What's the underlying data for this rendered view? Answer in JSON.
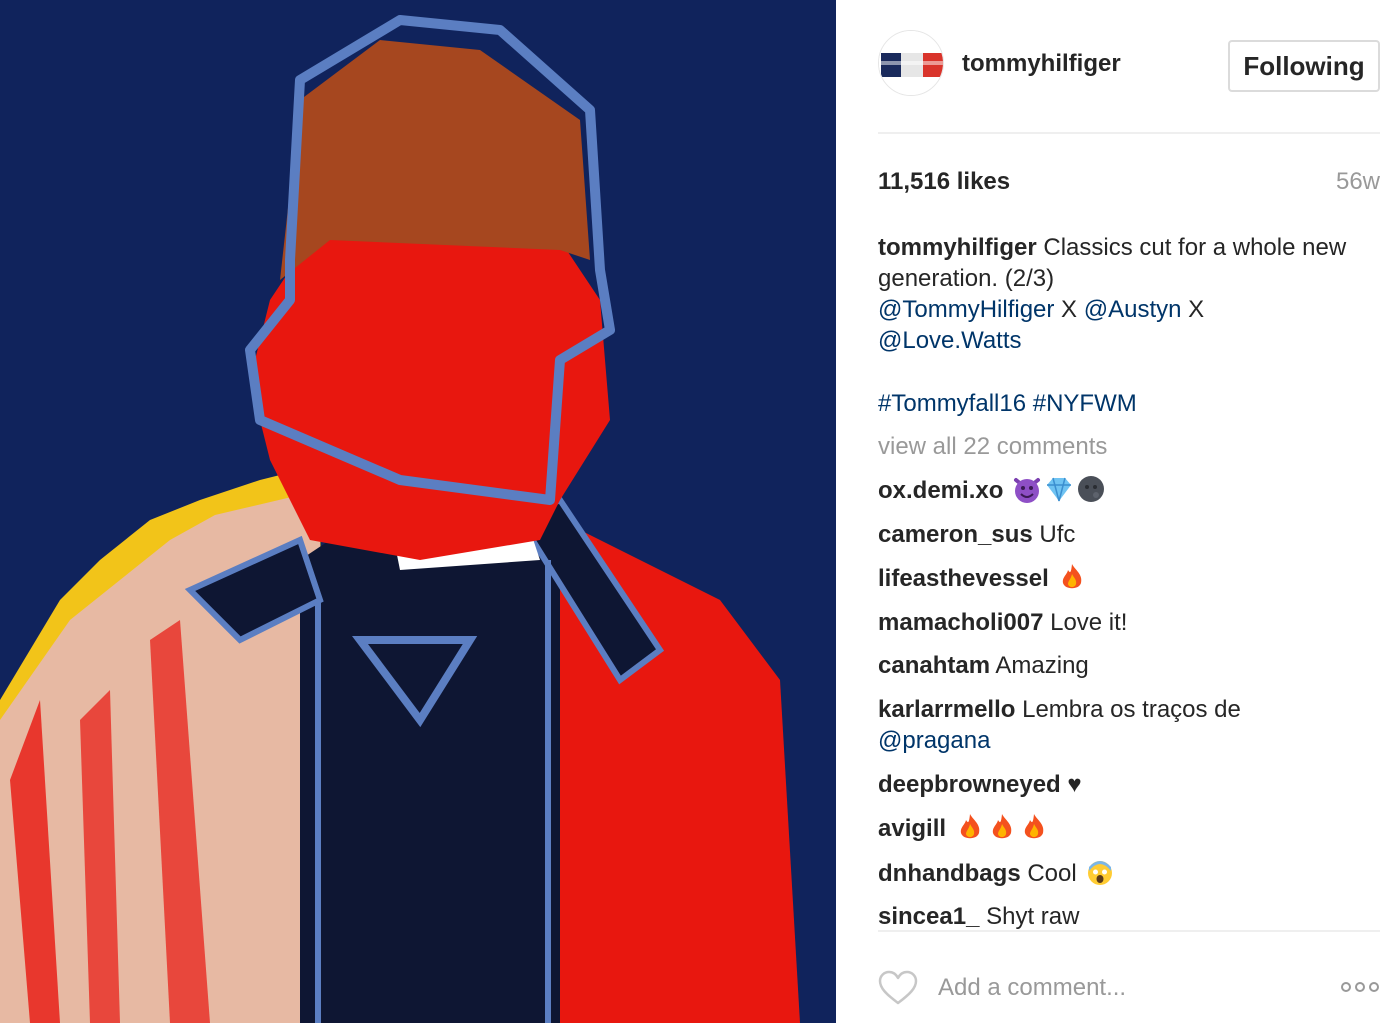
{
  "post": {
    "author": {
      "username": "tommyhilfiger",
      "avatar_icon": "tommy-hilfiger-flag-logo",
      "follow_label": "Following"
    },
    "likes": "11,516 likes",
    "timestamp": "56w",
    "caption": {
      "username": "tommyhilfiger",
      "text_line": "Classics cut for a whole new generation. (2/3)",
      "mention1": "@TommyHilfiger",
      "sep1": " X ",
      "mention2": "@Austyn",
      "sep2": " X",
      "mention3": "@Love.Watts",
      "hashtag1": "#Tommyfall16",
      "hashtag2": "#NYFWM"
    },
    "view_all": "view all 22 comments",
    "comments": [
      {
        "user": "ox.demi.xo",
        "text": "",
        "emoji": [
          "smiling-devil-emoji",
          "gem-emoji",
          "new-moon-face-emoji"
        ]
      },
      {
        "user": "cameron_sus",
        "text": "Ufc"
      },
      {
        "user": "lifeasthevessel",
        "text": "",
        "emoji": [
          "fire-emoji"
        ]
      },
      {
        "user": "mamacholi007",
        "text": "Love it!"
      },
      {
        "user": "canahtam",
        "text": "Amazing"
      },
      {
        "user": "karlarrmello",
        "text": "Lembra os traços de",
        "mention": "@pragana"
      },
      {
        "user": "deepbrowneyed",
        "text": "♥"
      },
      {
        "user": "avigill",
        "text": "",
        "emoji": [
          "fire-emoji",
          "fire-emoji",
          "fire-emoji"
        ]
      },
      {
        "user": "dnhandbags",
        "text": "Cool",
        "emoji": [
          "screaming-face-emoji"
        ]
      },
      {
        "user": "sincea1_",
        "text": "Shyt raw"
      }
    ],
    "add_comment_placeholder": "Add a comment...",
    "colors": {
      "link": "#003569",
      "muted": "#999999",
      "text": "#262626",
      "border": "#dbdbdb",
      "art_background": "#10235c",
      "art_red": "#e8170f",
      "art_outline": "#5b7ec2"
    }
  }
}
